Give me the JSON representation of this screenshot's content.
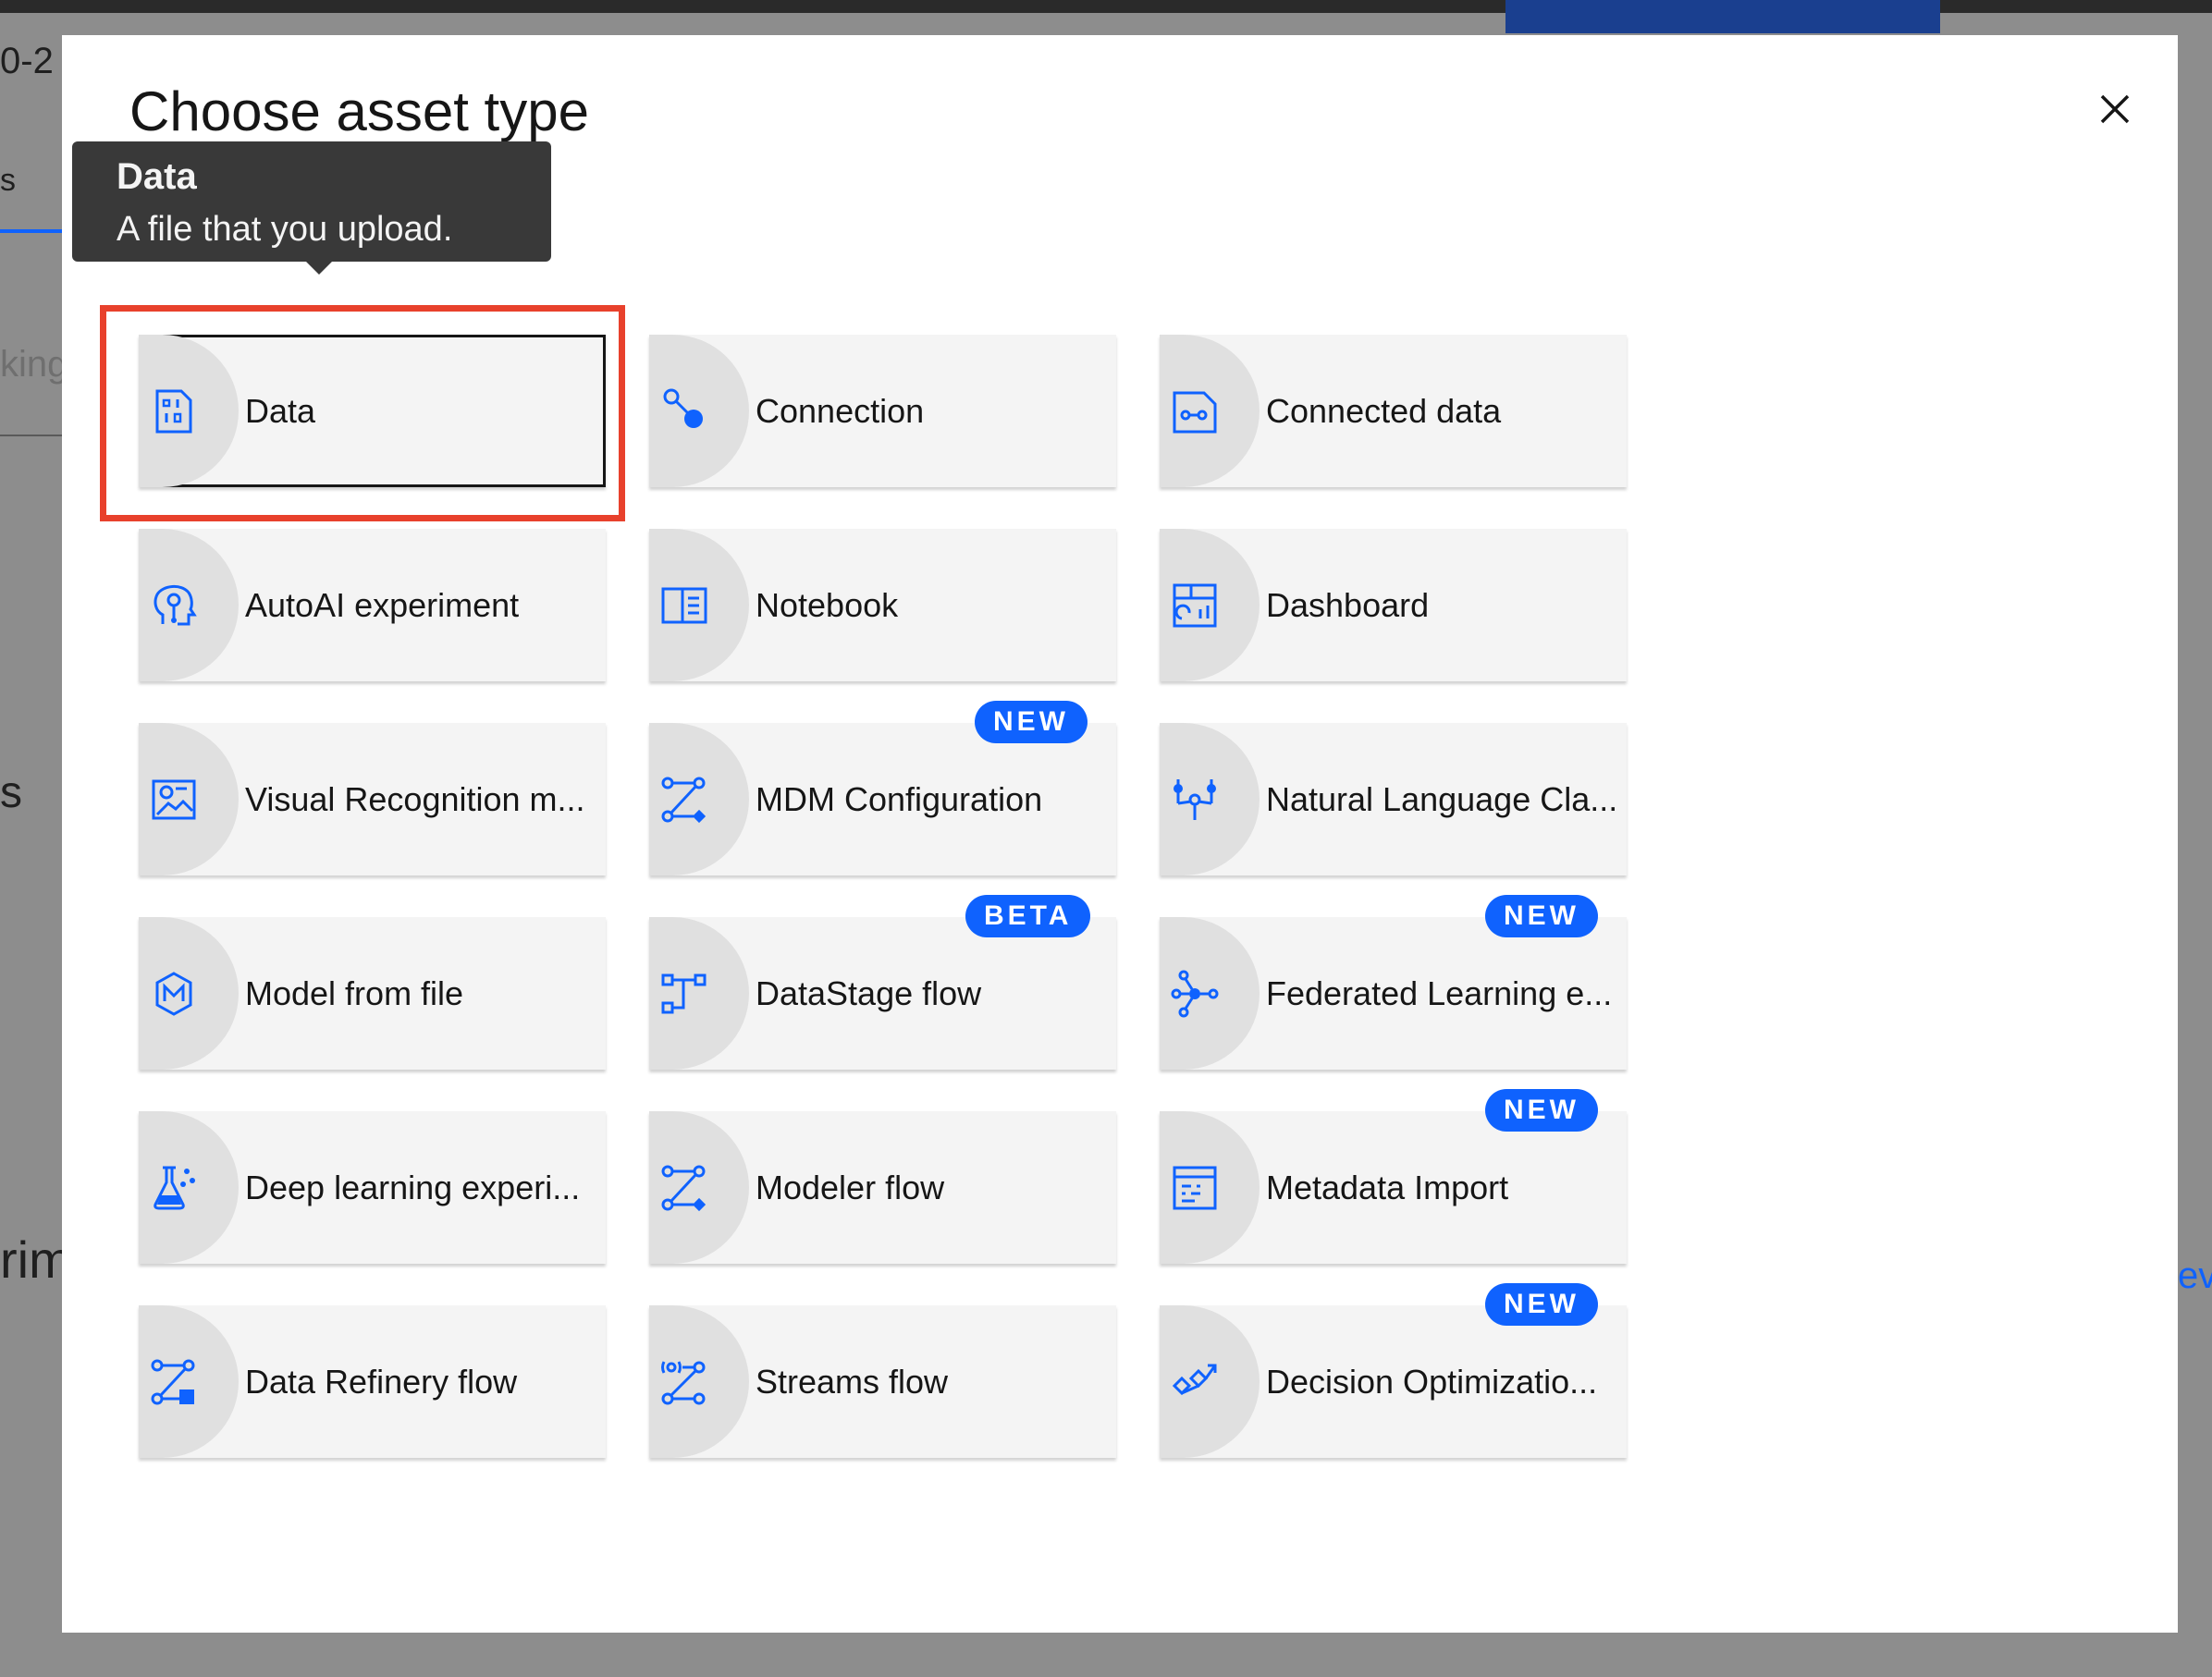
{
  "background": {
    "fragments": [
      "0-2",
      "s",
      "king",
      "s",
      "rim",
      "ev"
    ]
  },
  "modal": {
    "title": "Choose asset type",
    "close_label": "×"
  },
  "tooltip": {
    "title": "Data",
    "description": "A file that you upload."
  },
  "tiles": [
    {
      "label": "Data",
      "icon": "data-icon",
      "badge": ""
    },
    {
      "label": "Connection",
      "icon": "connection-icon",
      "badge": ""
    },
    {
      "label": "Connected data",
      "icon": "connected-data-icon",
      "badge": ""
    },
    {
      "label": "AutoAI experiment",
      "icon": "autoai-icon",
      "badge": ""
    },
    {
      "label": "Notebook",
      "icon": "notebook-icon",
      "badge": ""
    },
    {
      "label": "Dashboard",
      "icon": "dashboard-icon",
      "badge": ""
    },
    {
      "label": "Visual Recognition m...",
      "icon": "visual-recognition-icon",
      "badge": ""
    },
    {
      "label": "MDM Configuration",
      "icon": "mdm-configuration-icon",
      "badge": "NEW"
    },
    {
      "label": "Natural Language Cla...",
      "icon": "natural-language-icon",
      "badge": ""
    },
    {
      "label": "Model from file",
      "icon": "model-icon",
      "badge": ""
    },
    {
      "label": "DataStage flow",
      "icon": "datastage-icon",
      "badge": "BETA"
    },
    {
      "label": "Federated Learning e...",
      "icon": "federated-learning-icon",
      "badge": "NEW"
    },
    {
      "label": "Deep learning experi...",
      "icon": "deep-learning-icon",
      "badge": ""
    },
    {
      "label": "Modeler flow",
      "icon": "modeler-flow-icon",
      "badge": ""
    },
    {
      "label": "Metadata Import",
      "icon": "metadata-import-icon",
      "badge": "NEW"
    },
    {
      "label": "Data Refinery flow",
      "icon": "data-refinery-icon",
      "badge": ""
    },
    {
      "label": "Streams flow",
      "icon": "streams-flow-icon",
      "badge": ""
    },
    {
      "label": "Decision Optimizatio...",
      "icon": "decision-optimization-icon",
      "badge": "NEW"
    }
  ],
  "colors": {
    "accent": "#0f62fe",
    "highlight": "#e8412c",
    "tile_bg": "#f4f4f4",
    "tooltip_bg": "#393939"
  }
}
